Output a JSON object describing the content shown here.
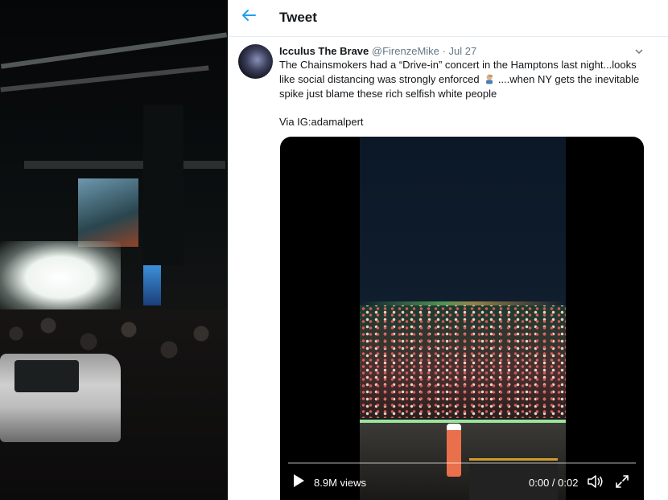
{
  "header": {
    "title": "Tweet"
  },
  "tweet": {
    "display_name": "Icculus The Brave",
    "handle": "@FirenzeMike",
    "separator": "·",
    "date": "Jul 27",
    "text_line1": "The Chainsmokers had a “Drive-in” concert in the Hamptons last night...looks",
    "text_line2a": "like social distancing was strongly enforced",
    "text_line2b": "....when NY gets the inevitable",
    "text_line3": "spike just blame these rich selfish white people",
    "via": "Via IG:adamalpert",
    "emoji_icon": "man-facepalming-emoji"
  },
  "video": {
    "views": "8.9M views",
    "time": "0:00 / 0:02",
    "play_icon": "play-icon",
    "volume_icon": "volume-icon",
    "fullscreen_icon": "fullscreen-icon",
    "progress": 0
  },
  "colors": {
    "accent": "#1da1f2",
    "text": "#14171a",
    "secondary_text": "#657786",
    "divider": "#e6ecf0"
  }
}
